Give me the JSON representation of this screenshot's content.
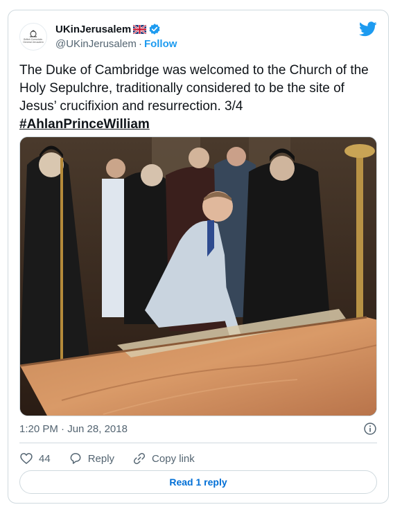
{
  "account": {
    "display_name": "UKinJerusalem",
    "handle": "@UKinJerusalem",
    "separator": "·",
    "follow_label": "Follow",
    "avatar_text": "British Consulate-General Jerusalem",
    "icons": {
      "flag": "uk-flag-icon",
      "verified": "verified-badge-icon",
      "logo": "twitter-bird-icon"
    }
  },
  "tweet": {
    "text": "The Duke of Cambridge was welcomed to the Church of the Holy Sepulchre, traditionally considered to be the site of Jesus’ crucifixion and resurrection.  3/4",
    "hashtag": "#AhlanPrinceWilliam",
    "timestamp": "1:20 PM · Jun 28, 2018"
  },
  "actions": {
    "like_count": "44",
    "reply_label": "Reply",
    "copy_link_label": "Copy link",
    "read_replies_label": "Read 1 reply"
  },
  "colors": {
    "accent": "#1d9bf0",
    "reply_button_text": "#006fd6",
    "secondary_text": "#536471",
    "border": "#cfd9de"
  }
}
